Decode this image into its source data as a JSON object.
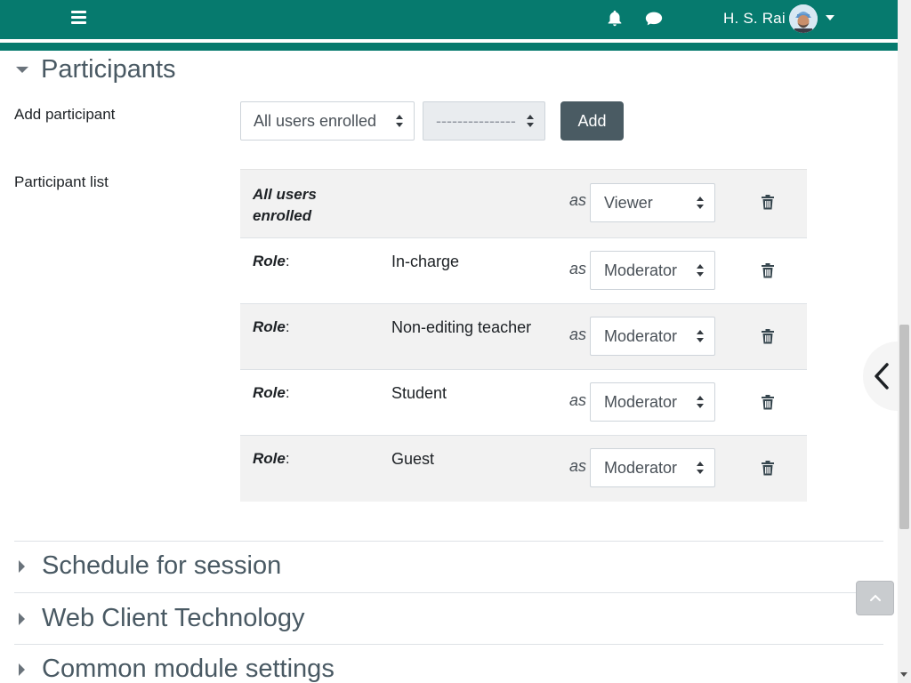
{
  "navbar": {
    "menu_icon": "hamburger-icon",
    "notifications_icon": "bell-icon",
    "messages_icon": "chat-icon",
    "user_name": "H. S. Rai",
    "user_menu_icon": "caret-down-icon",
    "bg_color": "#067a6e"
  },
  "participants": {
    "section_title": "Participants",
    "add_participant_label": "Add participant",
    "add_participant_select": "All users enrolled",
    "add_participant_sub_select": "---------------",
    "add_button": "Add",
    "participant_list_label": "Participant list",
    "as_label": "as",
    "rows": [
      {
        "type": "all",
        "name": "All users enrolled",
        "role_value": "Viewer"
      },
      {
        "type": "role",
        "role_label": "Role",
        "name": "In-charge",
        "role_value": "Moderator"
      },
      {
        "type": "role",
        "role_label": "Role",
        "name": "Non-editing teacher",
        "role_value": "Moderator"
      },
      {
        "type": "role",
        "role_label": "Role",
        "name": "Student",
        "role_value": "Moderator"
      },
      {
        "type": "role",
        "role_label": "Role",
        "name": "Guest",
        "role_value": "Moderator"
      }
    ]
  },
  "sections": {
    "schedule": "Schedule for session",
    "web_client": "Web Client Technology",
    "common_module": "Common module settings"
  },
  "colors": {
    "accent": "#067a6e",
    "button": "#4a5b63",
    "section_title": "#495963"
  }
}
